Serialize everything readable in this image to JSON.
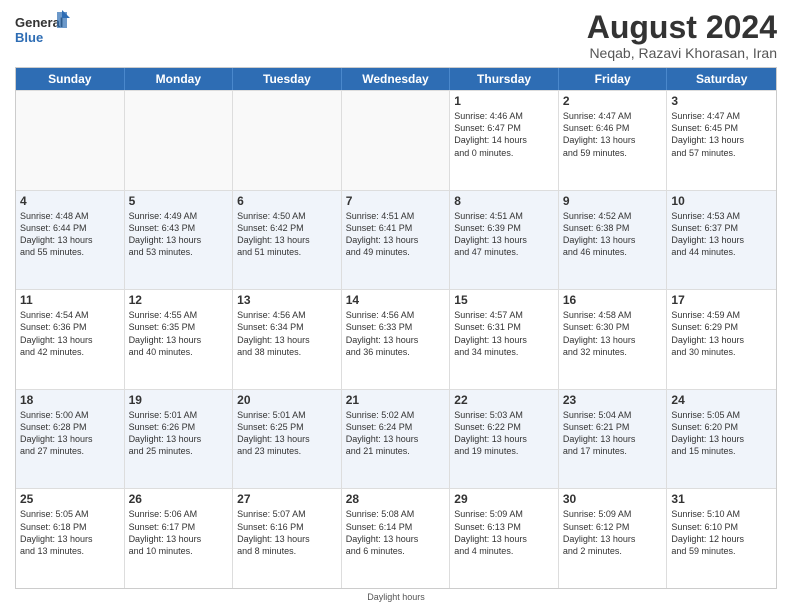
{
  "header": {
    "logo_general": "General",
    "logo_blue": "Blue",
    "month_year": "August 2024",
    "location": "Neqab, Razavi Khorasan, Iran"
  },
  "days_of_week": [
    "Sunday",
    "Monday",
    "Tuesday",
    "Wednesday",
    "Thursday",
    "Friday",
    "Saturday"
  ],
  "footer": "Daylight hours",
  "weeks": [
    [
      {
        "day": "",
        "text": "",
        "empty": true
      },
      {
        "day": "",
        "text": "",
        "empty": true
      },
      {
        "day": "",
        "text": "",
        "empty": true
      },
      {
        "day": "",
        "text": "",
        "empty": true
      },
      {
        "day": "1",
        "text": "Sunrise: 4:46 AM\nSunset: 6:47 PM\nDaylight: 14 hours\nand 0 minutes."
      },
      {
        "day": "2",
        "text": "Sunrise: 4:47 AM\nSunset: 6:46 PM\nDaylight: 13 hours\nand 59 minutes."
      },
      {
        "day": "3",
        "text": "Sunrise: 4:47 AM\nSunset: 6:45 PM\nDaylight: 13 hours\nand 57 minutes."
      }
    ],
    [
      {
        "day": "4",
        "text": "Sunrise: 4:48 AM\nSunset: 6:44 PM\nDaylight: 13 hours\nand 55 minutes."
      },
      {
        "day": "5",
        "text": "Sunrise: 4:49 AM\nSunset: 6:43 PM\nDaylight: 13 hours\nand 53 minutes."
      },
      {
        "day": "6",
        "text": "Sunrise: 4:50 AM\nSunset: 6:42 PM\nDaylight: 13 hours\nand 51 minutes."
      },
      {
        "day": "7",
        "text": "Sunrise: 4:51 AM\nSunset: 6:41 PM\nDaylight: 13 hours\nand 49 minutes."
      },
      {
        "day": "8",
        "text": "Sunrise: 4:51 AM\nSunset: 6:39 PM\nDaylight: 13 hours\nand 47 minutes."
      },
      {
        "day": "9",
        "text": "Sunrise: 4:52 AM\nSunset: 6:38 PM\nDaylight: 13 hours\nand 46 minutes."
      },
      {
        "day": "10",
        "text": "Sunrise: 4:53 AM\nSunset: 6:37 PM\nDaylight: 13 hours\nand 44 minutes."
      }
    ],
    [
      {
        "day": "11",
        "text": "Sunrise: 4:54 AM\nSunset: 6:36 PM\nDaylight: 13 hours\nand 42 minutes."
      },
      {
        "day": "12",
        "text": "Sunrise: 4:55 AM\nSunset: 6:35 PM\nDaylight: 13 hours\nand 40 minutes."
      },
      {
        "day": "13",
        "text": "Sunrise: 4:56 AM\nSunset: 6:34 PM\nDaylight: 13 hours\nand 38 minutes."
      },
      {
        "day": "14",
        "text": "Sunrise: 4:56 AM\nSunset: 6:33 PM\nDaylight: 13 hours\nand 36 minutes."
      },
      {
        "day": "15",
        "text": "Sunrise: 4:57 AM\nSunset: 6:31 PM\nDaylight: 13 hours\nand 34 minutes."
      },
      {
        "day": "16",
        "text": "Sunrise: 4:58 AM\nSunset: 6:30 PM\nDaylight: 13 hours\nand 32 minutes."
      },
      {
        "day": "17",
        "text": "Sunrise: 4:59 AM\nSunset: 6:29 PM\nDaylight: 13 hours\nand 30 minutes."
      }
    ],
    [
      {
        "day": "18",
        "text": "Sunrise: 5:00 AM\nSunset: 6:28 PM\nDaylight: 13 hours\nand 27 minutes."
      },
      {
        "day": "19",
        "text": "Sunrise: 5:01 AM\nSunset: 6:26 PM\nDaylight: 13 hours\nand 25 minutes."
      },
      {
        "day": "20",
        "text": "Sunrise: 5:01 AM\nSunset: 6:25 PM\nDaylight: 13 hours\nand 23 minutes."
      },
      {
        "day": "21",
        "text": "Sunrise: 5:02 AM\nSunset: 6:24 PM\nDaylight: 13 hours\nand 21 minutes."
      },
      {
        "day": "22",
        "text": "Sunrise: 5:03 AM\nSunset: 6:22 PM\nDaylight: 13 hours\nand 19 minutes."
      },
      {
        "day": "23",
        "text": "Sunrise: 5:04 AM\nSunset: 6:21 PM\nDaylight: 13 hours\nand 17 minutes."
      },
      {
        "day": "24",
        "text": "Sunrise: 5:05 AM\nSunset: 6:20 PM\nDaylight: 13 hours\nand 15 minutes."
      }
    ],
    [
      {
        "day": "25",
        "text": "Sunrise: 5:05 AM\nSunset: 6:18 PM\nDaylight: 13 hours\nand 13 minutes."
      },
      {
        "day": "26",
        "text": "Sunrise: 5:06 AM\nSunset: 6:17 PM\nDaylight: 13 hours\nand 10 minutes."
      },
      {
        "day": "27",
        "text": "Sunrise: 5:07 AM\nSunset: 6:16 PM\nDaylight: 13 hours\nand 8 minutes."
      },
      {
        "day": "28",
        "text": "Sunrise: 5:08 AM\nSunset: 6:14 PM\nDaylight: 13 hours\nand 6 minutes."
      },
      {
        "day": "29",
        "text": "Sunrise: 5:09 AM\nSunset: 6:13 PM\nDaylight: 13 hours\nand 4 minutes."
      },
      {
        "day": "30",
        "text": "Sunrise: 5:09 AM\nSunset: 6:12 PM\nDaylight: 13 hours\nand 2 minutes."
      },
      {
        "day": "31",
        "text": "Sunrise: 5:10 AM\nSunset: 6:10 PM\nDaylight: 12 hours\nand 59 minutes."
      }
    ]
  ]
}
